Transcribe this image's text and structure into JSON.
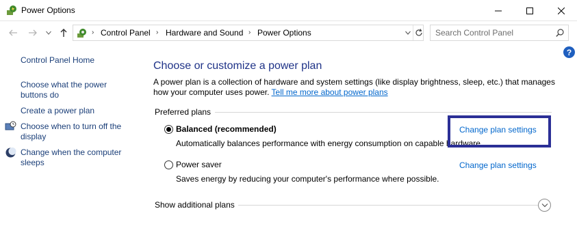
{
  "window": {
    "title": "Power Options",
    "minimize_icon": "minimize-icon",
    "maximize_icon": "maximize-icon",
    "close_icon": "close-icon"
  },
  "address_bar": {
    "breadcrumbs": [
      "Control Panel",
      "Hardware and Sound",
      "Power Options"
    ],
    "search_placeholder": "Search Control Panel"
  },
  "help": {
    "label": "?"
  },
  "sidebar": {
    "items": [
      {
        "label": "Control Panel Home",
        "icon": null
      },
      {
        "label": "Choose what the power buttons do",
        "icon": null
      },
      {
        "label": "Create a power plan",
        "icon": null
      },
      {
        "label": "Choose when to turn off the display",
        "icon": "display-clock-icon"
      },
      {
        "label": "Change when the computer sleeps",
        "icon": "moon-icon"
      }
    ]
  },
  "main": {
    "heading": "Choose or customize a power plan",
    "description": "A power plan is a collection of hardware and system settings (like display brightness, sleep, etc.) that manages how your computer uses power.",
    "learn_more": "Tell me more about power plans",
    "group_label": "Preferred plans",
    "plans": [
      {
        "name": "Balanced (recommended)",
        "description": "Automatically balances performance with energy consumption on capable hardware.",
        "link": "Change plan settings",
        "selected": true
      },
      {
        "name": "Power saver",
        "description": "Saves energy by reducing your computer's performance where possible.",
        "link": "Change plan settings",
        "selected": false
      }
    ],
    "show_additional": "Show additional plans"
  },
  "colors": {
    "heading": "#1e3287",
    "link": "#0066cc",
    "sidebar_link": "#1a3e78",
    "highlight": "#2b2f96"
  }
}
